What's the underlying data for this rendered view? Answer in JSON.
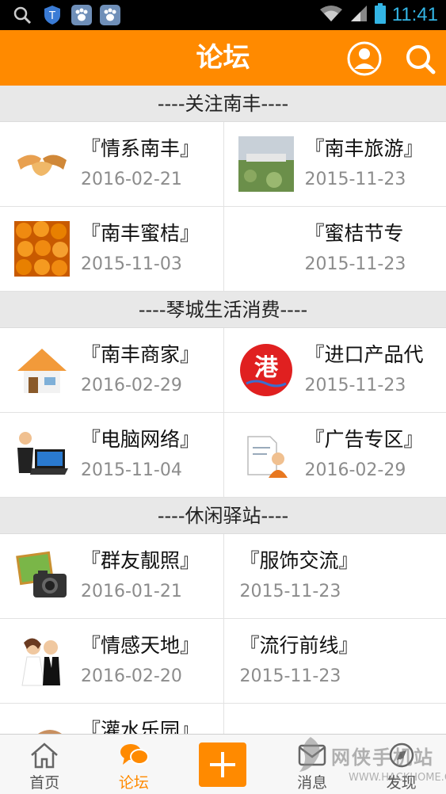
{
  "status_bar": {
    "time": "11:41"
  },
  "header": {
    "title": "论坛"
  },
  "sections": [
    {
      "title": "----关注南丰----",
      "items": [
        {
          "name": "『情系南丰』",
          "date": "2016-02-21",
          "icon": "handshake-icon"
        },
        {
          "name": "『南丰旅游』",
          "date": "2015-11-23",
          "icon": "landscape-photo"
        },
        {
          "name": "『南丰蜜桔』",
          "date": "2015-11-03",
          "icon": "tangerines-photo"
        },
        {
          "name": "『蜜桔节专",
          "date": "2015-11-23",
          "icon": "none"
        }
      ]
    },
    {
      "title": "----琴城生活消费----",
      "items": [
        {
          "name": "『南丰商家』",
          "date": "2016-02-29",
          "icon": "house-icon"
        },
        {
          "name": "『进口产品代",
          "date": "2015-11-23",
          "icon": "port-logo-icon"
        },
        {
          "name": "『电脑网络』",
          "date": "2015-11-04",
          "icon": "laptop-user-icon"
        },
        {
          "name": "『广告专区』",
          "date": "2016-02-29",
          "icon": "document-person-icon"
        }
      ]
    },
    {
      "title": "----休闲驿站----",
      "items": [
        {
          "name": "『群友靓照』",
          "date": "2016-01-21",
          "icon": "camera-photo-icon"
        },
        {
          "name": "『服饰交流』",
          "date": "2015-11-23",
          "icon": "none"
        },
        {
          "name": "『情感天地』",
          "date": "2016-02-20",
          "icon": "couple-icon"
        },
        {
          "name": "『流行前线』",
          "date": "2015-11-23",
          "icon": "none"
        },
        {
          "name": "『灌水乐园』",
          "date": "",
          "icon": "partial-icon"
        }
      ]
    }
  ],
  "tabs": [
    {
      "label": "首页",
      "icon": "home-icon"
    },
    {
      "label": "论坛",
      "icon": "chat-bubbles-icon",
      "active": true
    },
    {
      "label": "",
      "icon": "plus-icon"
    },
    {
      "label": "消息",
      "icon": "message-icon"
    },
    {
      "label": "发现",
      "icon": "discover-icon"
    }
  ],
  "watermark": {
    "text": "网侠手机站",
    "sub": "WWW.HACKHOME.COM"
  },
  "colors": {
    "accent": "#ff8a00",
    "status_time": "#33b5e5"
  }
}
